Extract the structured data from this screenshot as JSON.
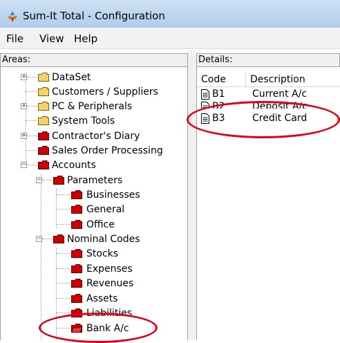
{
  "window": {
    "title": "Sum-It Total - Configuration"
  },
  "menu": [
    "File",
    "View",
    "Help"
  ],
  "areas_label": "Areas:",
  "details_label": "Details:",
  "tree": [
    {
      "label": "DataSet",
      "expander": "+"
    },
    {
      "label": "Customers / Suppliers",
      "expander": ""
    },
    {
      "label": "PC & Peripherals",
      "expander": "+"
    },
    {
      "label": "System Tools",
      "expander": ""
    },
    {
      "label": "Contractor's Diary",
      "expander": "+"
    },
    {
      "label": "Sales Order Processing",
      "expander": ""
    },
    {
      "label": "Accounts",
      "expander": "−"
    },
    {
      "label": "Parameters",
      "expander": "−"
    },
    {
      "label": "Businesses",
      "expander": ""
    },
    {
      "label": "General",
      "expander": ""
    },
    {
      "label": "Office",
      "expander": ""
    },
    {
      "label": "Nominal Codes",
      "expander": "−"
    },
    {
      "label": "Stocks",
      "expander": ""
    },
    {
      "label": "Expenses",
      "expander": ""
    },
    {
      "label": "Revenues",
      "expander": ""
    },
    {
      "label": "Assets",
      "expander": ""
    },
    {
      "label": "Liabilities",
      "expander": ""
    },
    {
      "label": "Bank A/c",
      "expander": ""
    }
  ],
  "details": {
    "columns": [
      "Code",
      "Description"
    ],
    "rows": [
      {
        "code": "B1",
        "description": "Current A/c"
      },
      {
        "code": "B2",
        "description": "Deposit A/c"
      },
      {
        "code": "B3",
        "description": "Credit Card"
      }
    ]
  },
  "colors": {
    "highlight": "#e0001b",
    "folder_yellow": "#f5d36b",
    "folder_red": "#cc0000"
  }
}
